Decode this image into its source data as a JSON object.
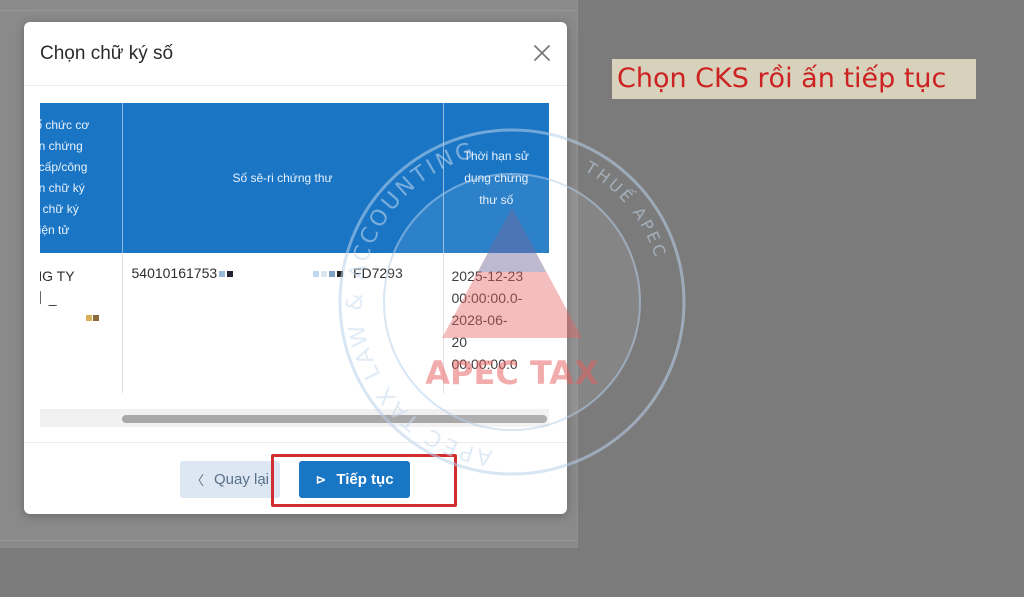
{
  "dialog": {
    "title": "Chọn chữ ký số",
    "close_icon": "close-icon"
  },
  "table": {
    "headers": [
      "tổ chức cơ\nan chứng\n:/cấp/công\nận chữ ký\n), chữ ký\nđiện tử",
      "Số sê-ri chứng thư",
      "Thời hạn sử\ndụng chứng\nthư số"
    ],
    "row": {
      "org": "NG TY\nㅐ _",
      "serial_start": "54010161753",
      "serial_end": "FD7293",
      "validity": "2025-12-23\n00:00:00.0-\n2028-06-\n20\n00:00:00.0"
    }
  },
  "footer": {
    "back_label": "Quay lại",
    "next_label": "Tiếp tục",
    "back_icon": "chevron-left-icon",
    "next_icon": "sign-icon"
  },
  "annotation": {
    "text": "Chọn CKS rồi ấn tiếp tục"
  },
  "watermark": {
    "brand": "APEC TAX",
    "ring_text": "APEC TAX LAW & ACCOUNTING",
    "top_text": "THUẾ APEC"
  },
  "colors": {
    "header_blue": "#1a76c5",
    "primary_button": "#1976c4",
    "highlight_red": "#d12f2f",
    "annotation_text": "#cc2222"
  }
}
